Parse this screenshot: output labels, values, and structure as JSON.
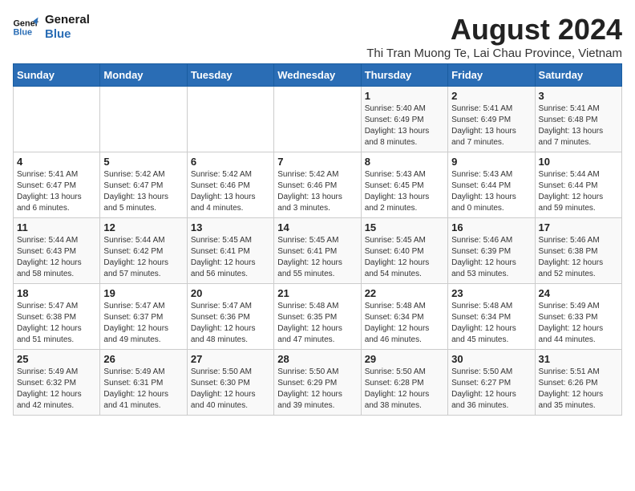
{
  "logo": {
    "line1": "General",
    "line2": "Blue"
  },
  "title": "August 2024",
  "subtitle": "Thi Tran Muong Te, Lai Chau Province, Vietnam",
  "days_of_week": [
    "Sunday",
    "Monday",
    "Tuesday",
    "Wednesday",
    "Thursday",
    "Friday",
    "Saturday"
  ],
  "weeks": [
    [
      {
        "day": "",
        "info": ""
      },
      {
        "day": "",
        "info": ""
      },
      {
        "day": "",
        "info": ""
      },
      {
        "day": "",
        "info": ""
      },
      {
        "day": "1",
        "info": "Sunrise: 5:40 AM\nSunset: 6:49 PM\nDaylight: 13 hours and 8 minutes."
      },
      {
        "day": "2",
        "info": "Sunrise: 5:41 AM\nSunset: 6:49 PM\nDaylight: 13 hours and 7 minutes."
      },
      {
        "day": "3",
        "info": "Sunrise: 5:41 AM\nSunset: 6:48 PM\nDaylight: 13 hours and 7 minutes."
      }
    ],
    [
      {
        "day": "4",
        "info": "Sunrise: 5:41 AM\nSunset: 6:47 PM\nDaylight: 13 hours and 6 minutes."
      },
      {
        "day": "5",
        "info": "Sunrise: 5:42 AM\nSunset: 6:47 PM\nDaylight: 13 hours and 5 minutes."
      },
      {
        "day": "6",
        "info": "Sunrise: 5:42 AM\nSunset: 6:46 PM\nDaylight: 13 hours and 4 minutes."
      },
      {
        "day": "7",
        "info": "Sunrise: 5:42 AM\nSunset: 6:46 PM\nDaylight: 13 hours and 3 minutes."
      },
      {
        "day": "8",
        "info": "Sunrise: 5:43 AM\nSunset: 6:45 PM\nDaylight: 13 hours and 2 minutes."
      },
      {
        "day": "9",
        "info": "Sunrise: 5:43 AM\nSunset: 6:44 PM\nDaylight: 13 hours and 0 minutes."
      },
      {
        "day": "10",
        "info": "Sunrise: 5:44 AM\nSunset: 6:44 PM\nDaylight: 12 hours and 59 minutes."
      }
    ],
    [
      {
        "day": "11",
        "info": "Sunrise: 5:44 AM\nSunset: 6:43 PM\nDaylight: 12 hours and 58 minutes."
      },
      {
        "day": "12",
        "info": "Sunrise: 5:44 AM\nSunset: 6:42 PM\nDaylight: 12 hours and 57 minutes."
      },
      {
        "day": "13",
        "info": "Sunrise: 5:45 AM\nSunset: 6:41 PM\nDaylight: 12 hours and 56 minutes."
      },
      {
        "day": "14",
        "info": "Sunrise: 5:45 AM\nSunset: 6:41 PM\nDaylight: 12 hours and 55 minutes."
      },
      {
        "day": "15",
        "info": "Sunrise: 5:45 AM\nSunset: 6:40 PM\nDaylight: 12 hours and 54 minutes."
      },
      {
        "day": "16",
        "info": "Sunrise: 5:46 AM\nSunset: 6:39 PM\nDaylight: 12 hours and 53 minutes."
      },
      {
        "day": "17",
        "info": "Sunrise: 5:46 AM\nSunset: 6:38 PM\nDaylight: 12 hours and 52 minutes."
      }
    ],
    [
      {
        "day": "18",
        "info": "Sunrise: 5:47 AM\nSunset: 6:38 PM\nDaylight: 12 hours and 51 minutes."
      },
      {
        "day": "19",
        "info": "Sunrise: 5:47 AM\nSunset: 6:37 PM\nDaylight: 12 hours and 49 minutes."
      },
      {
        "day": "20",
        "info": "Sunrise: 5:47 AM\nSunset: 6:36 PM\nDaylight: 12 hours and 48 minutes."
      },
      {
        "day": "21",
        "info": "Sunrise: 5:48 AM\nSunset: 6:35 PM\nDaylight: 12 hours and 47 minutes."
      },
      {
        "day": "22",
        "info": "Sunrise: 5:48 AM\nSunset: 6:34 PM\nDaylight: 12 hours and 46 minutes."
      },
      {
        "day": "23",
        "info": "Sunrise: 5:48 AM\nSunset: 6:34 PM\nDaylight: 12 hours and 45 minutes."
      },
      {
        "day": "24",
        "info": "Sunrise: 5:49 AM\nSunset: 6:33 PM\nDaylight: 12 hours and 44 minutes."
      }
    ],
    [
      {
        "day": "25",
        "info": "Sunrise: 5:49 AM\nSunset: 6:32 PM\nDaylight: 12 hours and 42 minutes."
      },
      {
        "day": "26",
        "info": "Sunrise: 5:49 AM\nSunset: 6:31 PM\nDaylight: 12 hours and 41 minutes."
      },
      {
        "day": "27",
        "info": "Sunrise: 5:50 AM\nSunset: 6:30 PM\nDaylight: 12 hours and 40 minutes."
      },
      {
        "day": "28",
        "info": "Sunrise: 5:50 AM\nSunset: 6:29 PM\nDaylight: 12 hours and 39 minutes."
      },
      {
        "day": "29",
        "info": "Sunrise: 5:50 AM\nSunset: 6:28 PM\nDaylight: 12 hours and 38 minutes."
      },
      {
        "day": "30",
        "info": "Sunrise: 5:50 AM\nSunset: 6:27 PM\nDaylight: 12 hours and 36 minutes."
      },
      {
        "day": "31",
        "info": "Sunrise: 5:51 AM\nSunset: 6:26 PM\nDaylight: 12 hours and 35 minutes."
      }
    ]
  ]
}
